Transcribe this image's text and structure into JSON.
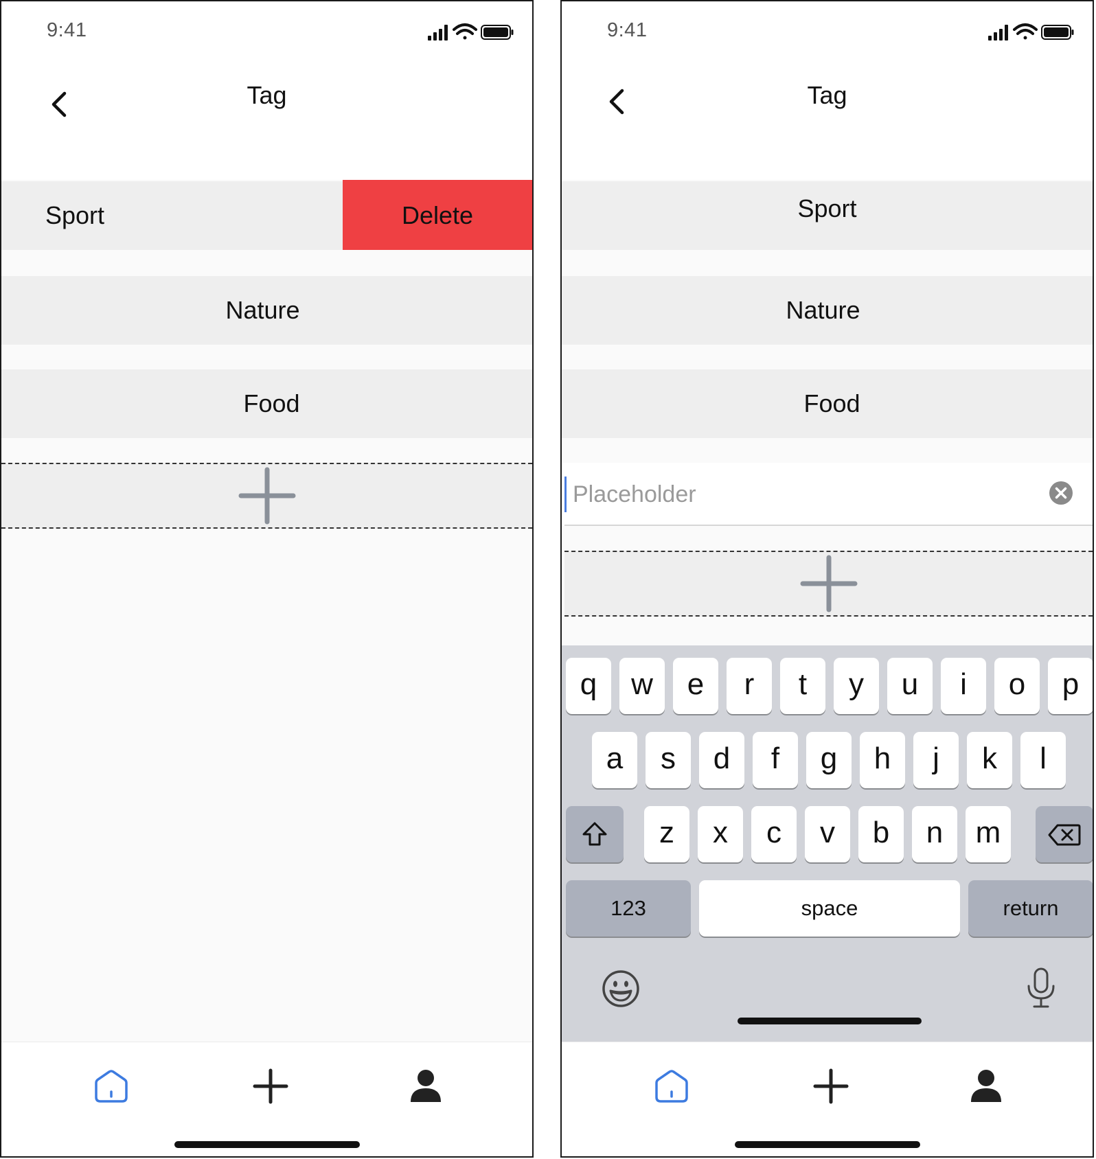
{
  "status_bar": {
    "time": "9:41"
  },
  "header": {
    "title": "Tag",
    "back_icon": "chevron-left-icon"
  },
  "left_screen": {
    "tags": [
      {
        "label": "Sport",
        "swiped": true
      },
      {
        "label": "Nature"
      },
      {
        "label": "Food"
      }
    ],
    "delete_label": "Delete",
    "delete_color": "#ef4043"
  },
  "right_screen": {
    "tags": [
      {
        "label": "Sport"
      },
      {
        "label": "Nature"
      },
      {
        "label": "Food"
      }
    ],
    "new_tag_input": {
      "value": "",
      "placeholder": "Placeholder"
    }
  },
  "keyboard": {
    "row1": [
      "q",
      "w",
      "e",
      "r",
      "t",
      "y",
      "u",
      "i",
      "o",
      "p"
    ],
    "row2": [
      "a",
      "s",
      "d",
      "f",
      "g",
      "h",
      "j",
      "k",
      "l"
    ],
    "row3": [
      "z",
      "x",
      "c",
      "v",
      "b",
      "n",
      "m"
    ],
    "numbers_label": "123",
    "space_label": "space",
    "return_label": "return"
  },
  "tab_bar": {
    "items": [
      {
        "icon": "home-icon",
        "active": true
      },
      {
        "icon": "plus-icon",
        "active": false
      },
      {
        "icon": "user-icon",
        "active": false
      }
    ],
    "active_color": "#3d7be0",
    "inactive_color": "#222222"
  }
}
